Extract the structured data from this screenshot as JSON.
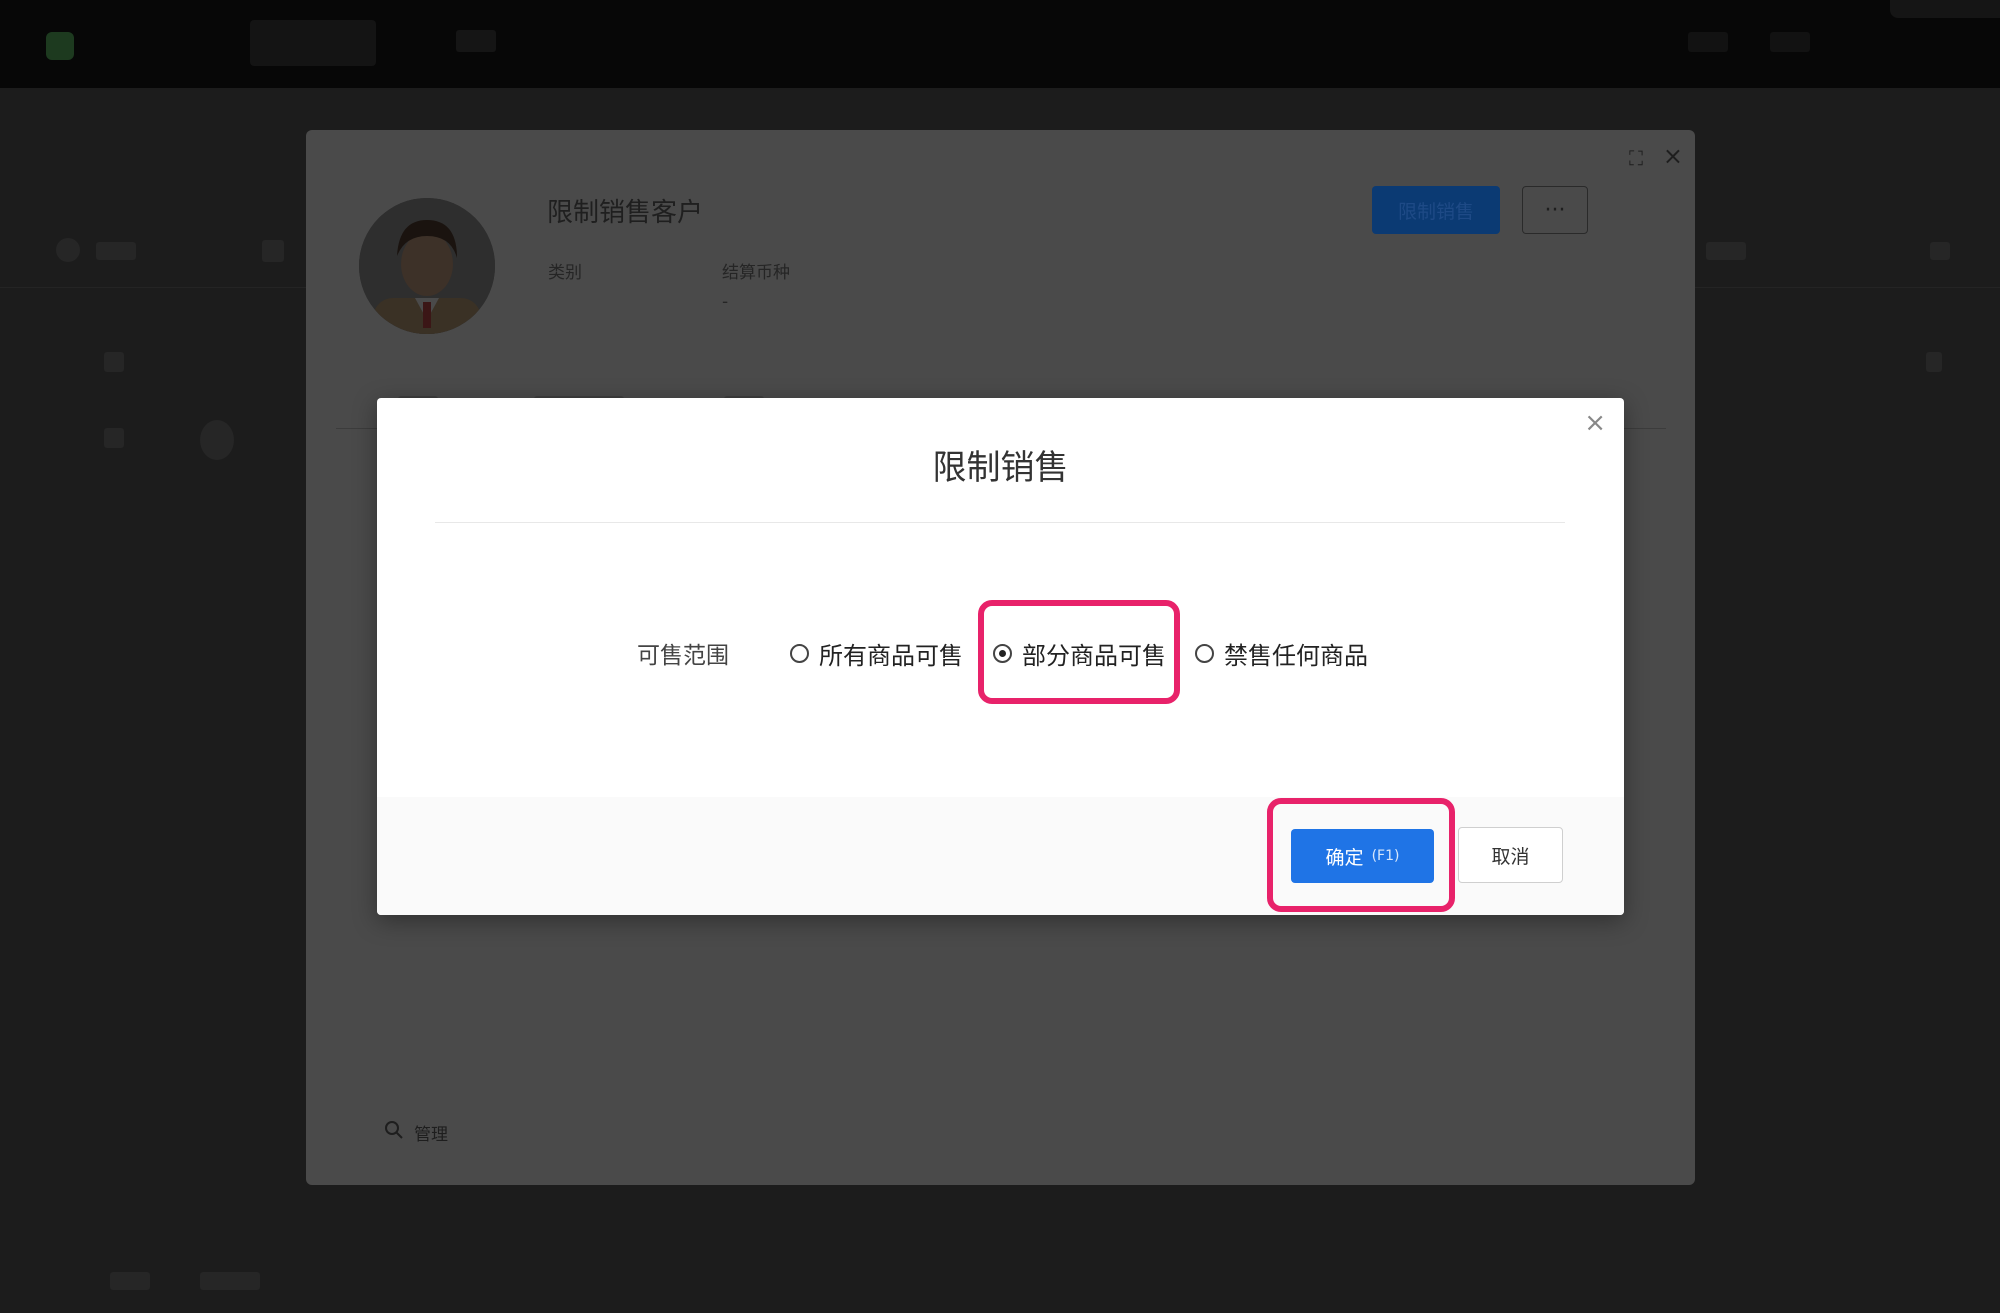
{
  "app": {
    "title": ""
  },
  "detail_panel": {
    "customer_name": "限制销售客户",
    "fields": [
      {
        "label": "类别",
        "value": ""
      },
      {
        "label": "结算币种",
        "value": "-"
      }
    ],
    "restrict_button": "限制销售",
    "more_button": "···",
    "expand_icon": "expand-icon",
    "close_icon": "close-icon",
    "search_label": "管理"
  },
  "modal": {
    "title": "限制销售",
    "close_label": "×",
    "range_label": "可售范围",
    "options": [
      {
        "label": "所有商品可售",
        "checked": false
      },
      {
        "label": "部分商品可售",
        "checked": true
      },
      {
        "label": "禁售任何商品",
        "checked": false
      }
    ],
    "confirm_label": "确定",
    "confirm_shortcut": "(F1)",
    "cancel_label": "取消"
  },
  "colors": {
    "primary": "#1f74e6",
    "highlight": "#e8226a",
    "overlay": "#1c1c1c"
  }
}
